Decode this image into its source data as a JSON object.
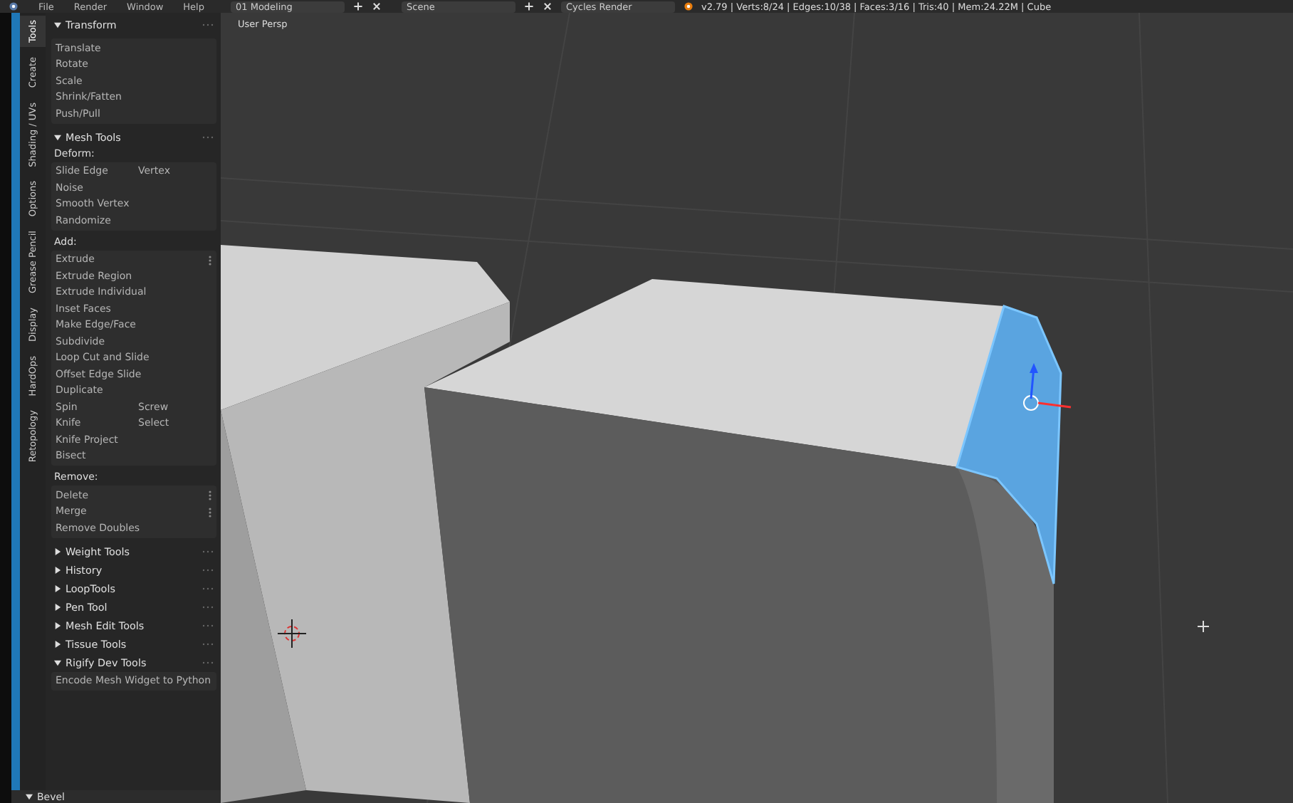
{
  "header": {
    "menus": [
      "File",
      "Render",
      "Window",
      "Help"
    ],
    "screen": "01 Modeling",
    "scene": "Scene",
    "engine": "Cycles Render",
    "stats": "v2.79 | Verts:8/24 | Edges:10/38 | Faces:3/16 | Tris:40 | Mem:24.22M | Cube"
  },
  "tool_tabs": [
    {
      "label": "Tools",
      "selected": true
    },
    {
      "label": "Create",
      "selected": false
    },
    {
      "label": "Shading / UVs",
      "selected": false
    },
    {
      "label": "Options",
      "selected": false
    },
    {
      "label": "Grease Pencil",
      "selected": false
    },
    {
      "label": "Display",
      "selected": false
    },
    {
      "label": "HardOps",
      "selected": false
    },
    {
      "label": "Retopology",
      "selected": false
    }
  ],
  "panels": [
    {
      "title": "Transform",
      "expanded": true,
      "groups": [
        {
          "rows": [
            {
              "labels": [
                "Translate"
              ],
              "menu": false
            },
            {
              "labels": [
                "Rotate"
              ],
              "menu": false
            },
            {
              "labels": [
                "Scale"
              ],
              "menu": false
            },
            {
              "labels": [
                "Shrink/Fatten"
              ],
              "menu": false
            },
            {
              "labels": [
                "Push/Pull"
              ],
              "menu": false
            }
          ]
        }
      ]
    },
    {
      "title": "Mesh Tools",
      "expanded": true,
      "groups": [
        {
          "heading": "Deform:",
          "rows": [
            {
              "labels": [
                "Slide Edge",
                "Vertex"
              ],
              "menu": false
            },
            {
              "labels": [
                "Noise"
              ],
              "menu": false
            },
            {
              "labels": [
                "Smooth Vertex"
              ],
              "menu": false
            },
            {
              "labels": [
                "Randomize"
              ],
              "menu": false
            }
          ]
        },
        {
          "heading": "Add:",
          "rows": [
            {
              "labels": [
                "Extrude"
              ],
              "menu": true
            },
            {
              "labels": [
                "Extrude Region"
              ],
              "menu": false
            },
            {
              "labels": [
                "Extrude Individual"
              ],
              "menu": false
            },
            {
              "labels": [
                "Inset Faces"
              ],
              "menu": false
            },
            {
              "labels": [
                "Make Edge/Face"
              ],
              "menu": false
            },
            {
              "labels": [
                "Subdivide"
              ],
              "menu": false
            },
            {
              "labels": [
                "Loop Cut and Slide"
              ],
              "menu": false
            },
            {
              "labels": [
                "Offset Edge Slide"
              ],
              "menu": false
            },
            {
              "labels": [
                "Duplicate"
              ],
              "menu": false
            },
            {
              "labels": [
                "Spin",
                "Screw"
              ],
              "menu": false
            },
            {
              "labels": [
                "Knife",
                "Select"
              ],
              "menu": false
            },
            {
              "labels": [
                "Knife Project"
              ],
              "menu": false
            },
            {
              "labels": [
                "Bisect"
              ],
              "menu": false
            }
          ]
        },
        {
          "heading": "Remove:",
          "rows": [
            {
              "labels": [
                "Delete"
              ],
              "menu": true
            },
            {
              "labels": [
                "Merge"
              ],
              "menu": true
            },
            {
              "labels": [
                "Remove Doubles"
              ],
              "menu": false
            }
          ]
        }
      ]
    },
    {
      "title": "Weight Tools",
      "expanded": false
    },
    {
      "title": "History",
      "expanded": false
    },
    {
      "title": "LoopTools",
      "expanded": false
    },
    {
      "title": "Pen Tool",
      "expanded": false
    },
    {
      "title": "Mesh Edit Tools",
      "expanded": false
    },
    {
      "title": "Tissue Tools",
      "expanded": false
    },
    {
      "title": "Rigify Dev Tools",
      "expanded": true,
      "groups": [
        {
          "rows": [
            {
              "labels": [
                "Encode Mesh Widget to Python"
              ],
              "menu": false
            }
          ]
        }
      ]
    }
  ],
  "operator_panel": {
    "title": "Bevel",
    "expanded": true
  },
  "viewport": {
    "label": "User Persp"
  }
}
